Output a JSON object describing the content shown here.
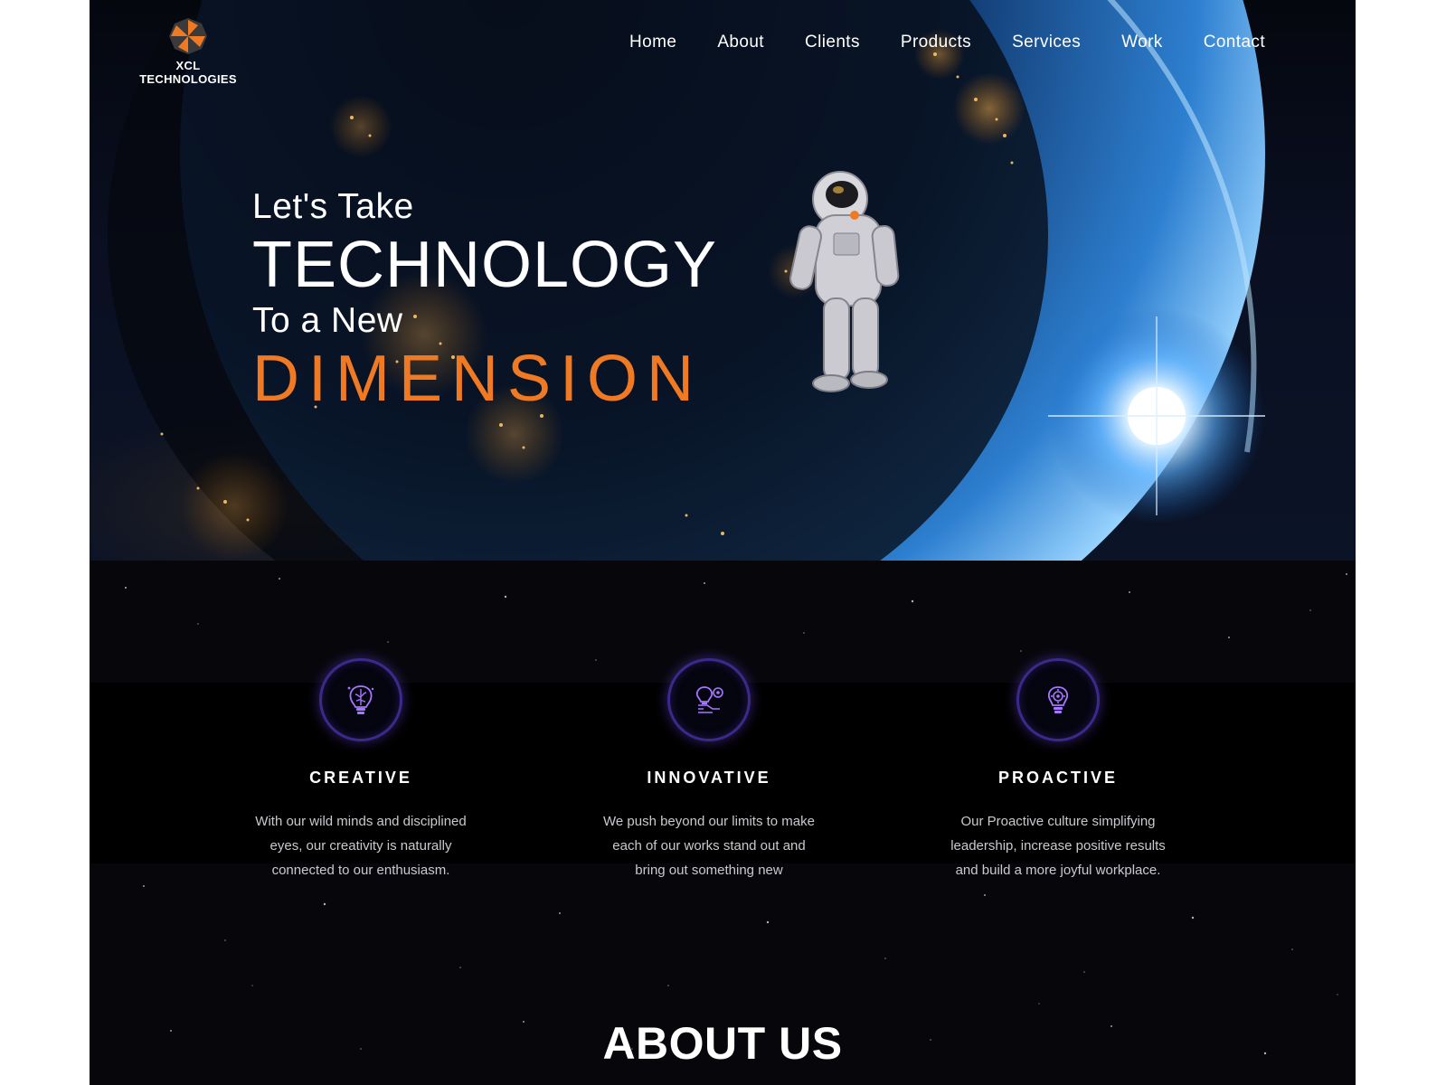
{
  "brand": {
    "name": "XCL TECHNOLOGIES",
    "logo_icon": "orange-pinwheel-logo-icon"
  },
  "nav": {
    "items": [
      {
        "label": "Home"
      },
      {
        "label": "About"
      },
      {
        "label": "Clients"
      },
      {
        "label": "Products"
      },
      {
        "label": "Services"
      },
      {
        "label": "Work"
      },
      {
        "label": "Contact"
      }
    ]
  },
  "hero": {
    "line1": "Let's Take",
    "line2": "TECHNOLOGY",
    "line3": "To a New",
    "line4": "DIMENSION"
  },
  "features": [
    {
      "icon": "brain-bulb-icon",
      "title": "CREATIVE",
      "text": "With our wild minds and disciplined eyes, our creativity is naturally connected to our enthusiasm."
    },
    {
      "icon": "bulb-gear-hand-icon",
      "title": "INNOVATIVE",
      "text": "We push beyond our limits to make each of our works stand out and bring out something new"
    },
    {
      "icon": "gear-bulb-icon",
      "title": "PROACTIVE",
      "text": "Our Proactive culture simplifying leadership, increase positive results and build a more joyful workplace."
    }
  ],
  "about": {
    "title": "ABOUT US"
  },
  "colors": {
    "accent": "#f07a23",
    "icon_ring": "#3a2a8a",
    "background": "#07070b"
  }
}
